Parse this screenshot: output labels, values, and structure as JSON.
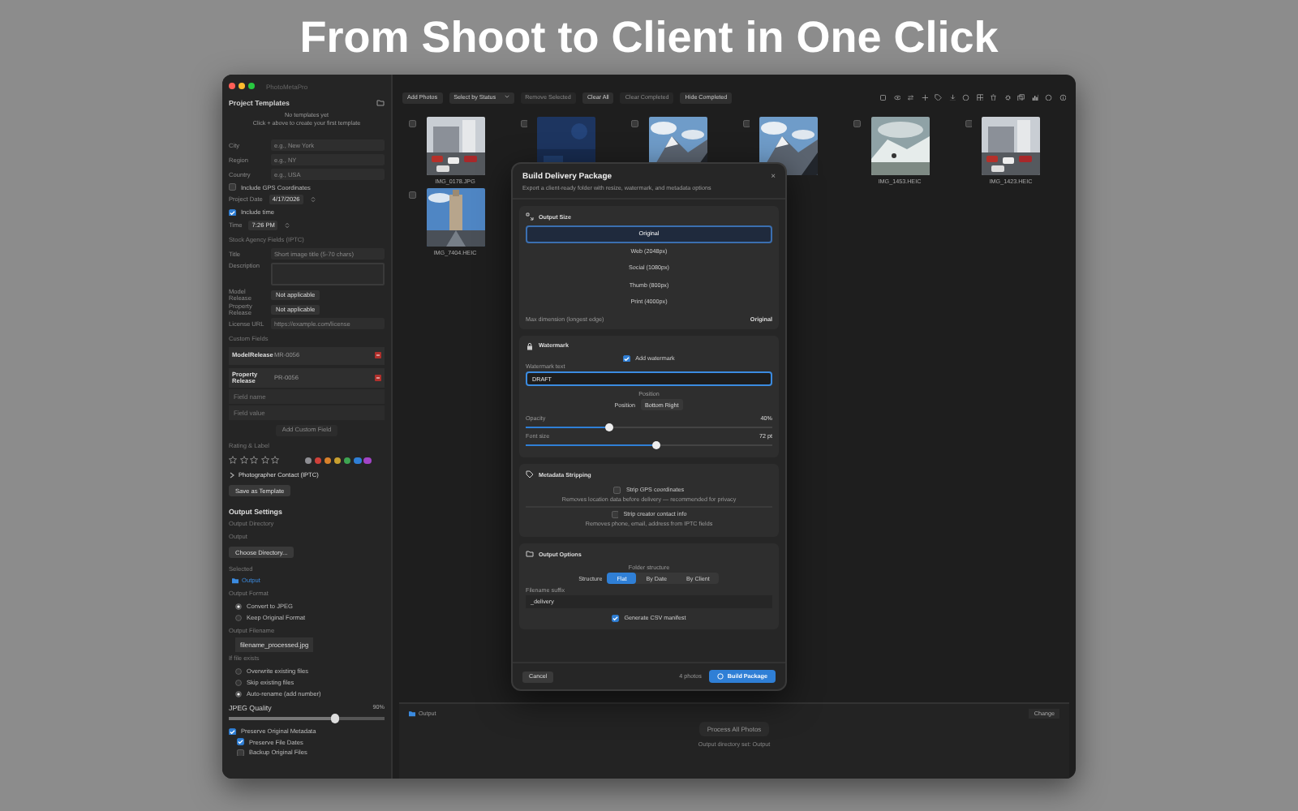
{
  "headline": "From Shoot to Client in One Click",
  "window": {
    "title": "PhotoMetaPro"
  },
  "sidebar": {
    "title": "Project Templates",
    "notes": [
      "No templates yet",
      "Click + above to create your first template"
    ],
    "items": [
      {
        "kind": "field",
        "label": "City",
        "placeholder": "e.g., New York"
      },
      {
        "kind": "field",
        "label": "Region",
        "placeholder": "e.g., NY"
      },
      {
        "kind": "field",
        "label": "Country",
        "placeholder": "e.g., USA"
      },
      {
        "kind": "check",
        "label": "Include GPS Coordinates",
        "checked": false
      },
      {
        "kind": "stepper",
        "label": "Project Date",
        "value": "4/17/2026"
      },
      {
        "kind": "check",
        "label": "Include time",
        "checked": true
      },
      {
        "kind": "stepper",
        "label": "Time",
        "value": "7:26 PM"
      },
      {
        "kind": "caption",
        "label": "Stock Agency Fields (IPTC)"
      },
      {
        "kind": "field",
        "label": "Title",
        "placeholder": "Short image title (5-70 chars)"
      },
      {
        "kind": "textarea",
        "label": "Description"
      },
      {
        "kind": "select",
        "label": "Model Release",
        "value": "Not applicable"
      },
      {
        "kind": "select",
        "label": "Property Release",
        "value": "Not applicable"
      },
      {
        "kind": "field",
        "label": "License URL",
        "placeholder": "https://example.com/license"
      },
      {
        "kind": "caption",
        "label": "Custom Fields"
      },
      {
        "kind": "custom",
        "name": "ModelRelease",
        "value": "MR-0056"
      },
      {
        "kind": "custom",
        "name": "Property Release",
        "value": "PR-0056"
      },
      {
        "kind": "input",
        "placeholder": "Field name"
      },
      {
        "kind": "input",
        "placeholder": "Field value"
      },
      {
        "kind": "button",
        "label": "Add Custom Field",
        "disabled": true
      },
      {
        "kind": "caption",
        "label": "Rating & Label"
      },
      {
        "kind": "rating",
        "stars": 0,
        "labels": [
          {
            "color": "#8e8e93"
          },
          {
            "color": "#d0413a"
          },
          {
            "color": "#d9822b"
          },
          {
            "color": "#c9a030"
          },
          {
            "color": "#3ea552"
          },
          {
            "color": "#2f7fd6"
          },
          {
            "color": "#a244c6"
          }
        ]
      },
      {
        "kind": "disclosure",
        "label": "Photographer Contact (IPTC)"
      },
      {
        "kind": "button",
        "label": "Save as Template",
        "disabled": false
      },
      {
        "kind": "section",
        "label": "Output Settings"
      },
      {
        "kind": "caption",
        "label": "Output Directory"
      },
      {
        "kind": "caption",
        "label": "Output"
      },
      {
        "kind": "button",
        "label": "Choose Directory...",
        "disabled": false
      },
      {
        "kind": "caption",
        "label": "Selected"
      },
      {
        "kind": "link",
        "label": "Output"
      },
      {
        "kind": "caption",
        "label": "Output Format"
      },
      {
        "kind": "radio",
        "label": "Convert to JPEG",
        "selected": true
      },
      {
        "kind": "radio",
        "label": "Keep Original Format",
        "selected": false
      },
      {
        "kind": "caption",
        "label": "Output Filename"
      },
      {
        "kind": "dropdown",
        "value": "filename_processed.jpg"
      },
      {
        "kind": "caption",
        "label": "If file exists"
      },
      {
        "kind": "radio",
        "label": "Overwrite existing files",
        "selected": false
      },
      {
        "kind": "radio",
        "label": "Skip existing files",
        "selected": false
      },
      {
        "kind": "radio",
        "label": "Auto-rename (add number)",
        "selected": true
      },
      {
        "kind": "quality",
        "label": "JPEG Quality",
        "reading": "90%",
        "level": 0.68
      },
      {
        "kind": "check",
        "label": "Preserve Original Metadata",
        "checked": true
      },
      {
        "kind": "subcheck",
        "label": "Preserve File Dates",
        "checked": true
      },
      {
        "kind": "subcheck",
        "label": "Backup Original Files",
        "checked": false
      }
    ]
  },
  "toolbar": [
    {
      "label": "Add Photos",
      "disabled": false
    },
    {
      "label": "Select by Status",
      "disabled": false,
      "menu": true
    },
    {
      "label": "Remove Selected",
      "disabled": true
    },
    {
      "label": "Clear All",
      "disabled": false
    },
    {
      "label": "Clear Completed",
      "disabled": true
    },
    {
      "label": "Hide Completed",
      "disabled": false
    }
  ],
  "photos": [
    {
      "kind": "picture",
      "name": "IMG_0178.JPG",
      "checked": false
    },
    {
      "kind": "picture",
      "checked": false
    },
    {
      "kind": "picture",
      "checked": false
    },
    {
      "kind": "picture",
      "checked": false
    },
    {
      "kind": "picture",
      "name": "IMG_1453.HEIC",
      "checked": false
    },
    {
      "kind": "picture",
      "name": "IMG_1423.HEIC",
      "checked": false
    },
    {
      "kind": "picture",
      "name": "IMG_7404.HEIC",
      "checked": false
    }
  ],
  "bottom_panel": {
    "output": "Output",
    "change": "Change",
    "process": "Process All Photos",
    "status": "Output directory set: Output"
  },
  "dialog": {
    "title": "Build Delivery Package",
    "subtitle": "Export a client-ready folder with resize, watermark, and metadata options",
    "close": "×",
    "output_size": {
      "title": "Output Size",
      "options": [
        {
          "label": "Original",
          "selected": true
        },
        {
          "label": "Web (2048px)",
          "selected": false
        },
        {
          "label": "Social (1080px)",
          "selected": false
        },
        {
          "label": "Thumb (800px)",
          "selected": false
        },
        {
          "label": "Print (4000px)",
          "selected": false
        }
      ],
      "max_label": "Max dimension (longest edge)",
      "max_value": "Original"
    },
    "watermark": {
      "title": "Watermark",
      "checkbox": {
        "label": "Add watermark",
        "checked": true
      },
      "text_label": "Watermark text",
      "text_value": "DRAFT",
      "position_caption": "Position",
      "position_label": "Position",
      "position_value": "Bottom Right",
      "sliders": [
        {
          "label": "Opacity",
          "reading": "40%",
          "level": 0.34
        },
        {
          "label": "Font size",
          "reading": "72 pt",
          "level": 0.53
        }
      ]
    },
    "metadata": {
      "title": "Metadata Stripping",
      "options": [
        {
          "label": "Strip GPS coordinates",
          "checked": false,
          "hint": "Removes location data before delivery — recommended for privacy"
        },
        {
          "label": "Strip creator contact info",
          "checked": false,
          "hint": "Removes phone, email, address from IPTC fields"
        }
      ]
    },
    "output_options": {
      "title": "Output Options",
      "structure_caption": "Folder structure",
      "structure_label": "Structure",
      "segments": [
        {
          "label": "Flat",
          "selected": true
        },
        {
          "label": "By Date",
          "selected": false
        },
        {
          "label": "By Client",
          "selected": false
        }
      ],
      "suffix_label": "Filename suffix",
      "suffix_value": "_delivery",
      "csv": {
        "label": "Generate CSV manifest",
        "checked": true
      }
    },
    "cancel": "Cancel",
    "count": "4 photos",
    "build": "Build Package"
  }
}
